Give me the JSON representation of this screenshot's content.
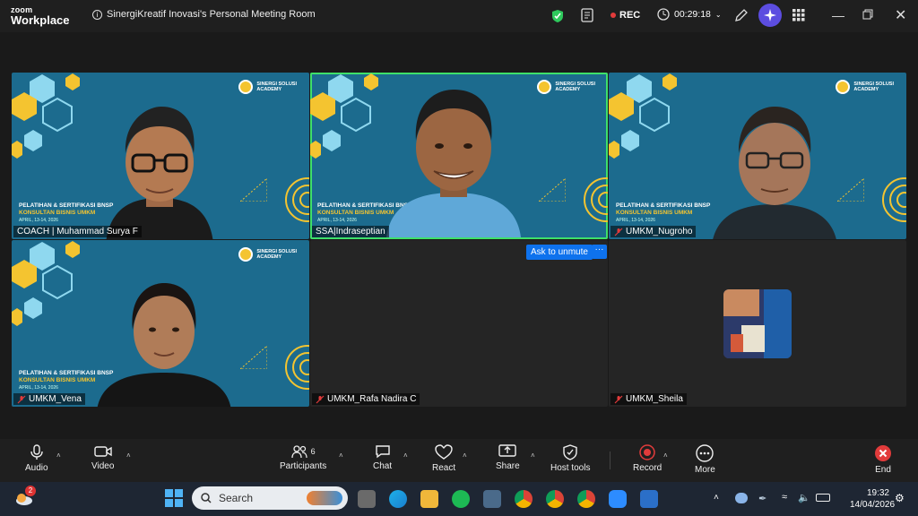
{
  "app": {
    "brand_top": "zoom",
    "brand_bottom": "Workplace"
  },
  "meeting": {
    "title": "SinergiKreatif Inovasi's Personal Meeting Room"
  },
  "header": {
    "rec_label": "REC",
    "timer": "00:29:18"
  },
  "tiles": [
    {
      "name": "COACH | Muhammad Surya F",
      "muted": false,
      "active": false
    },
    {
      "name": "SSA|Indraseptian",
      "muted": false,
      "active": true
    },
    {
      "name": "UMKM_Nugroho",
      "muted": true,
      "active": false
    },
    {
      "name": "UMKM_Vena",
      "muted": true,
      "active": false
    },
    {
      "name": "UMKM_Rafa Nadira C",
      "muted": true,
      "active": false
    },
    {
      "name": "UMKM_Sheila",
      "muted": true,
      "active": false
    }
  ],
  "background": {
    "brand_line1": "SINERGI SOLUSI",
    "brand_line2": "ACADEMY",
    "event_line1": "PELATIHAN & SERTIFIKASI BNSP",
    "event_line2": "KONSULTAN BISNIS UMKM",
    "event_line3": "APRIL, 13-14, 2026"
  },
  "unmute_button": "Ask to unmute",
  "toolbar": {
    "audio": "Audio",
    "video": "Video",
    "participants": "Participants",
    "participants_count": "6",
    "chat": "Chat",
    "react": "React",
    "share": "Share",
    "host_tools": "Host tools",
    "record": "Record",
    "more": "More",
    "end": "End"
  },
  "taskbar": {
    "weather_badge": "2",
    "search_placeholder": "Search",
    "time": "19:32",
    "date": "14/04/2026"
  },
  "colors": {
    "video_bg": "#1c6b8e",
    "accent_yellow": "#f4c430",
    "active_border": "#3ee06a",
    "button_blue": "#0e72ed",
    "record_red": "#e23b3b"
  }
}
